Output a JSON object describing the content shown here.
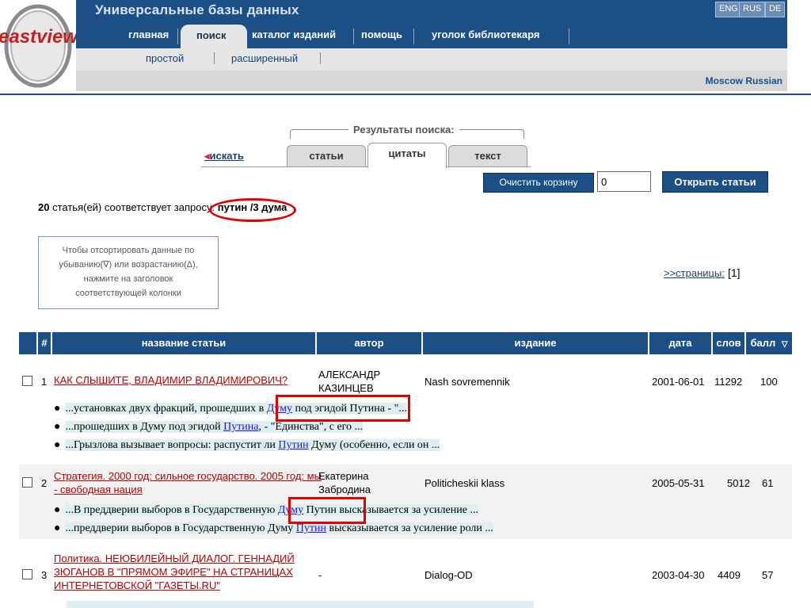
{
  "header": {
    "title": "Универсальные базы данных",
    "logo_text": "eastview",
    "langs": [
      "ENG",
      "RUS",
      "DE"
    ],
    "nav": [
      "главная",
      "поиск",
      "каталог изданий",
      "помощь",
      "уголок библиотекаря"
    ],
    "active_nav": "поиск",
    "subnav": [
      "простой",
      "расширенный"
    ],
    "region": "Moscow Russian"
  },
  "results": {
    "label": "Результаты поиска:",
    "search_link": "искать",
    "tabs": [
      "статьи",
      "цитаты",
      "текст"
    ],
    "active_tab": "цитаты"
  },
  "toolbar": {
    "clear_cart": "Очистить корзину",
    "cart_count": "0",
    "open_articles": "Открыть статьи"
  },
  "query": {
    "count": "20",
    "text": "статья(ей) соответствует запросу:",
    "query": "путин /3 дума"
  },
  "sort_hint": {
    "line1": "Чтобы отсортировать данные по",
    "line2": "убыванию(∇) или возрастанию(Δ),",
    "line3": "нажмите на заголовок",
    "line4": "соответствующей колонки"
  },
  "pages": {
    "label": ">>страницы:",
    "current": "[1]"
  },
  "table": {
    "headers": [
      "#",
      "название статьи",
      "автор",
      "издание",
      "дата",
      "слов",
      "балл"
    ],
    "rows": [
      {
        "n": "1",
        "title_lines": [
          "КАК СЛЫШИТЕ, ВЛАДИМИР ВЛАДИМИРОВИЧ?"
        ],
        "author_lines": [
          "АЛЕКСАНДР",
          "КАЗИНЦЕВ"
        ],
        "pub": "Nash sovremennik",
        "date": "2001-06-01",
        "words": "11292",
        "score": "100",
        "snippets": [
          {
            "pre": "...установках двух фракций, прошедших в ",
            "hl": "Думу",
            "post": " под эгидой Путина - \"..."
          },
          {
            "pre": "...прошедших в Думу под эгидой ",
            "hl": "Путина",
            "post": ", - \"Единства\", с его ..."
          },
          {
            "pre": "...Грызлова вызывает вопросы: распустит ли ",
            "hl": "Путин",
            "post": " Думу (особенно, если он ..."
          }
        ]
      },
      {
        "n": "2",
        "title_lines": [
          "Стратегия. 2000 год: сильное государство. 2005 год: мы",
          "- свободная нация"
        ],
        "author_lines": [
          "Екатерина",
          "Забродина"
        ],
        "pub": "Politicheskii klass",
        "date": "2005-05-31",
        "words": "5012",
        "score": "61",
        "snippets": [
          {
            "pre": "...В преддверии выборов в Государственную ",
            "hl": "Думу",
            "post": " Путин высказывается за усиление ..."
          },
          {
            "pre": "...преддверии выборов в Государственную Думу ",
            "hl": "Путин",
            "post": " высказывается за усиление роли ..."
          }
        ]
      },
      {
        "n": "3",
        "title_lines": [
          "Политика. НЕЮБИЛЕЙНЫЙ ДИАЛОГ. ГЕННАДИЙ",
          "ЗЮГАНОВ В \"ПРЯМОМ ЭФИРЕ\" НА СТРАНИЦАХ",
          "ИНТЕРНЕТОВСКОЙ \"ГАЗЕТЫ.RU\""
        ],
        "author_lines": [
          "-"
        ],
        "pub": "Dialog-OD",
        "date": "2003-04-30",
        "words": "4409",
        "score": "57",
        "snippets": []
      }
    ]
  },
  "colors": {
    "header_blue": "#1c4f86",
    "annotation_red": "#e00000",
    "title_red": "#b00000",
    "link_blue": "#1a1aee"
  },
  "icons": {
    "sort": "sort-desc-icon",
    "back": "arrow-left-icon"
  }
}
